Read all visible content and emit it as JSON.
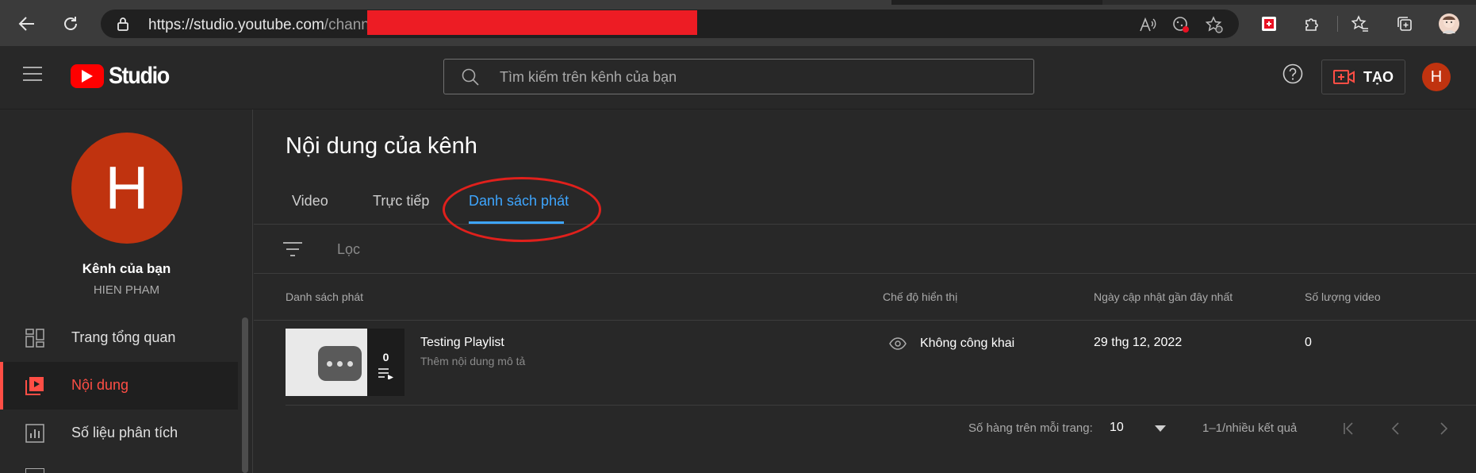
{
  "browser": {
    "url_visible": "https://studio.youtube.com/channel",
    "url_host": "https://studio.youtube.com",
    "url_path": "/channel"
  },
  "header": {
    "logo_text": "Studio",
    "search_placeholder": "Tìm kiếm trên kênh của bạn",
    "create_label": "TẠO",
    "avatar_initial": "H"
  },
  "sidebar": {
    "avatar_initial": "H",
    "channel_title": "Kênh của bạn",
    "channel_name": "HIEN PHAM",
    "items": [
      {
        "label": "Trang tổng quan",
        "icon": "dashboard-icon"
      },
      {
        "label": "Nội dung",
        "icon": "content-icon",
        "active": true
      },
      {
        "label": "Số liệu phân tích",
        "icon": "analytics-icon"
      }
    ]
  },
  "main": {
    "title": "Nội dung của kênh",
    "tabs": [
      {
        "label": "Video"
      },
      {
        "label": "Trực tiếp"
      },
      {
        "label": "Danh sách phát",
        "active": true
      }
    ],
    "filter_label": "Lọc",
    "columns": {
      "playlist": "Danh sách phát",
      "visibility": "Chế độ hiển thị",
      "updated": "Ngày cập nhật gần đây nhất",
      "video_count": "Số lượng video"
    },
    "rows": [
      {
        "thumb_count": "0",
        "title": "Testing Playlist",
        "description": "Thêm nội dung mô tả",
        "visibility": "Không công khai",
        "updated": "29 thg 12, 2022",
        "video_count": "0"
      }
    ],
    "pagination": {
      "rows_per_page_label": "Số hàng trên mỗi trang:",
      "rows_per_page_value": "10",
      "range_text": "1–1/nhiều kết quả"
    }
  },
  "colors": {
    "accent_blue": "#3ea6ff",
    "accent_red": "#ff4e45",
    "avatar": "#c0330f",
    "annotation": "#e0201c"
  }
}
